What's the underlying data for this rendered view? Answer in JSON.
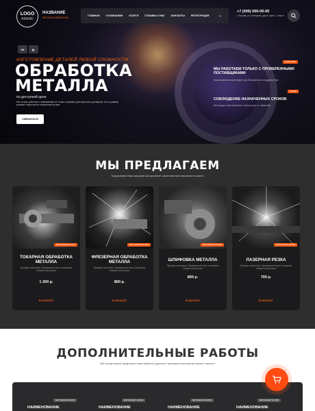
{
  "header": {
    "logo_line1": "LOGO",
    "logo_line2": "BRAND",
    "brand_name": "НАЗВАНИЕ",
    "brand_sub": "МЕТАЛЛООБРАБОТКА",
    "nav": [
      "ГЛАВНАЯ",
      "О КОМПАНИИ",
      "УСЛУГИ",
      "ОТЗЫВЫ О НАС",
      "КОНТАКТЫ",
      "РЕГИСТРАЦИЯ"
    ],
    "nav_more": "⌄",
    "phone": "+7 (000) 000-00-00",
    "address": "г. Москва, ул. Гончарова, дом 5 офис 1, этаж 5"
  },
  "social": {
    "vk": "VK",
    "youtube": "▶"
  },
  "hero": {
    "kicker": "ИЗГОТОВЛЕНИЕ ДЕТАЛЕЙ ЛЮБОЙ СЛОЖНОСТИ",
    "title_line1": "ОБРАБОТКА",
    "title_line2": "МЕТАЛЛА",
    "price_note": "по доступной цене",
    "description": "Мы готовы работать с компаниями не только в рамках долгосрочных договоров, но и в рамках разовых запросов на конкретные услуги",
    "button": "СВЯЗАТЬСЯ"
  },
  "advantages": [
    {
      "tag": "КАЧЕСТВО",
      "title": "МЫ РАБОТАЕМ ТОЛЬКО С ПРОВЕРЕННЫМИ ПОСТАВЩИКАМИ",
      "desc": "Наша компания гарантирует срок безупречного сотрудничества"
    },
    {
      "tag": "СРОКИ",
      "title": "СОБЛЮДЕНИЕ НАЗНАЧЕННЫХ СРОКОВ",
      "desc": "Мы всегда готовы выполнить заказ в срок и с гарантией"
    }
  ],
  "offer": {
    "title": "МЫ ПРЕДЛАГАЕМ",
    "subtitle": "Предлагаем Вам широкий ассортимент качественной автокинки и масел",
    "cards": [
      {
        "badge": "БЕТОННЫЙ ЗАЛОБ",
        "name": "ТОКАРНАЯ ОБРАБОТКА МЕТАЛЛА",
        "desc": "Пример описания. Примерный текст описания товара или услуги",
        "price": "1 200 р.",
        "cta": "В КАТАЛОГ"
      },
      {
        "badge": "БЕТОННЫЙ ЗАЛОБ",
        "name": "ФРЕЗЕРНАЯ ОБРАБОТКА МЕТАЛЛА",
        "desc": "Пример описания. Примерный текст описания товара или услуги",
        "price": "800 р.",
        "cta": "В КАТАЛОГ"
      },
      {
        "badge": "БЕТОННЫЙ ЗАЛОБ",
        "name": "ШЛИФОВКА МЕТАЛЛА",
        "desc": "Пример описания. Примерный текст описания товара или услуги",
        "price": "800 р.",
        "cta": "В КАТАЛОГ"
      },
      {
        "badge": "БЕТОННЫЙ ЗАЛОБ",
        "name": "ЛАЗЕРНАЯ РЕЗКА",
        "desc": "Пример описания. Примерный текст описания товара или услуги",
        "price": "700 р.",
        "cta": "В КАТАЛОГ"
      }
    ]
  },
  "extra": {
    "title": "ДОПОЛНИТЕЛЬНЫЕ РАБОТЫ",
    "subtitle": "Мы всегда можем предложить вам наиболее удачное и выгодное воплощение вашего проекта",
    "items": [
      {
        "badge": "БЕТОННЫЙ ЗАЛОБ",
        "name": "НАИМЕНОВАНИЕ"
      },
      {
        "badge": "БЕТОННЫЙ ЗАЛОБ",
        "name": "НАИМЕНОВАНИЕ"
      },
      {
        "badge": "БЕТОННЫЙ ЗАЛОБ",
        "name": "НАИМЕНОВАНИЕ"
      },
      {
        "badge": "БЕТОННЫЙ ЗАЛОБ",
        "name": "НАИМЕНОВАНИЕ"
      }
    ]
  },
  "colors": {
    "accent": "#ff5a14",
    "dark_section": "#2e2e2e",
    "card_bg": "#1b1b1d"
  },
  "icons": {
    "search": "search-icon",
    "cart": "cart-icon"
  }
}
